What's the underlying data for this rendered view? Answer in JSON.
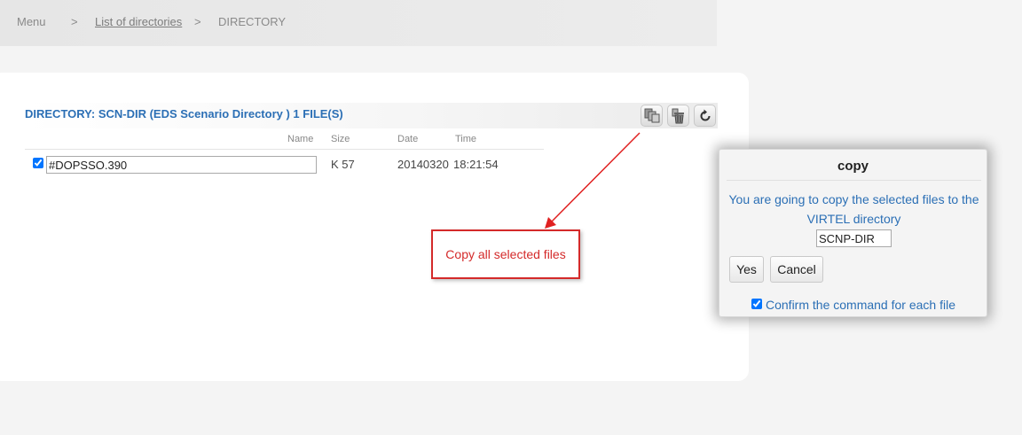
{
  "breadcrumb": {
    "menu": "Menu",
    "sep1": ">",
    "list_link": "List of directories",
    "sep2": ">",
    "current": "DIRECTORY"
  },
  "directory": {
    "title": "DIRECTORY: SCN-DIR (EDS Scenario Directory ) 1 FILE(S)",
    "toolbar": [
      {
        "icon": "copy-files-icon",
        "tooltip": "copy"
      },
      {
        "icon": "delete-files-icon",
        "tooltip": "delete"
      },
      {
        "icon": "refresh-icon",
        "tooltip": "refresh"
      }
    ],
    "columns": {
      "name": "Name",
      "size": "Size",
      "date": "Date",
      "time": "Time"
    },
    "rows": [
      {
        "checked": true,
        "name": "#DOPSSO.390",
        "size": "K 57",
        "date": "20140320",
        "time": "18:21:54"
      }
    ]
  },
  "annotation": {
    "text": "Copy all selected files",
    "color": "#d42a2a"
  },
  "dialog": {
    "title": "copy",
    "message": "You are going to copy the selected files to the VIRTEL directory",
    "target": "SCNP-DIR",
    "yes_label": "Yes",
    "cancel_label": "Cancel",
    "confirm_checked": true,
    "confirm_label": "Confirm the command for each file"
  },
  "colors": {
    "accent": "#2b6fb5",
    "annotation": "#d42a2a"
  }
}
